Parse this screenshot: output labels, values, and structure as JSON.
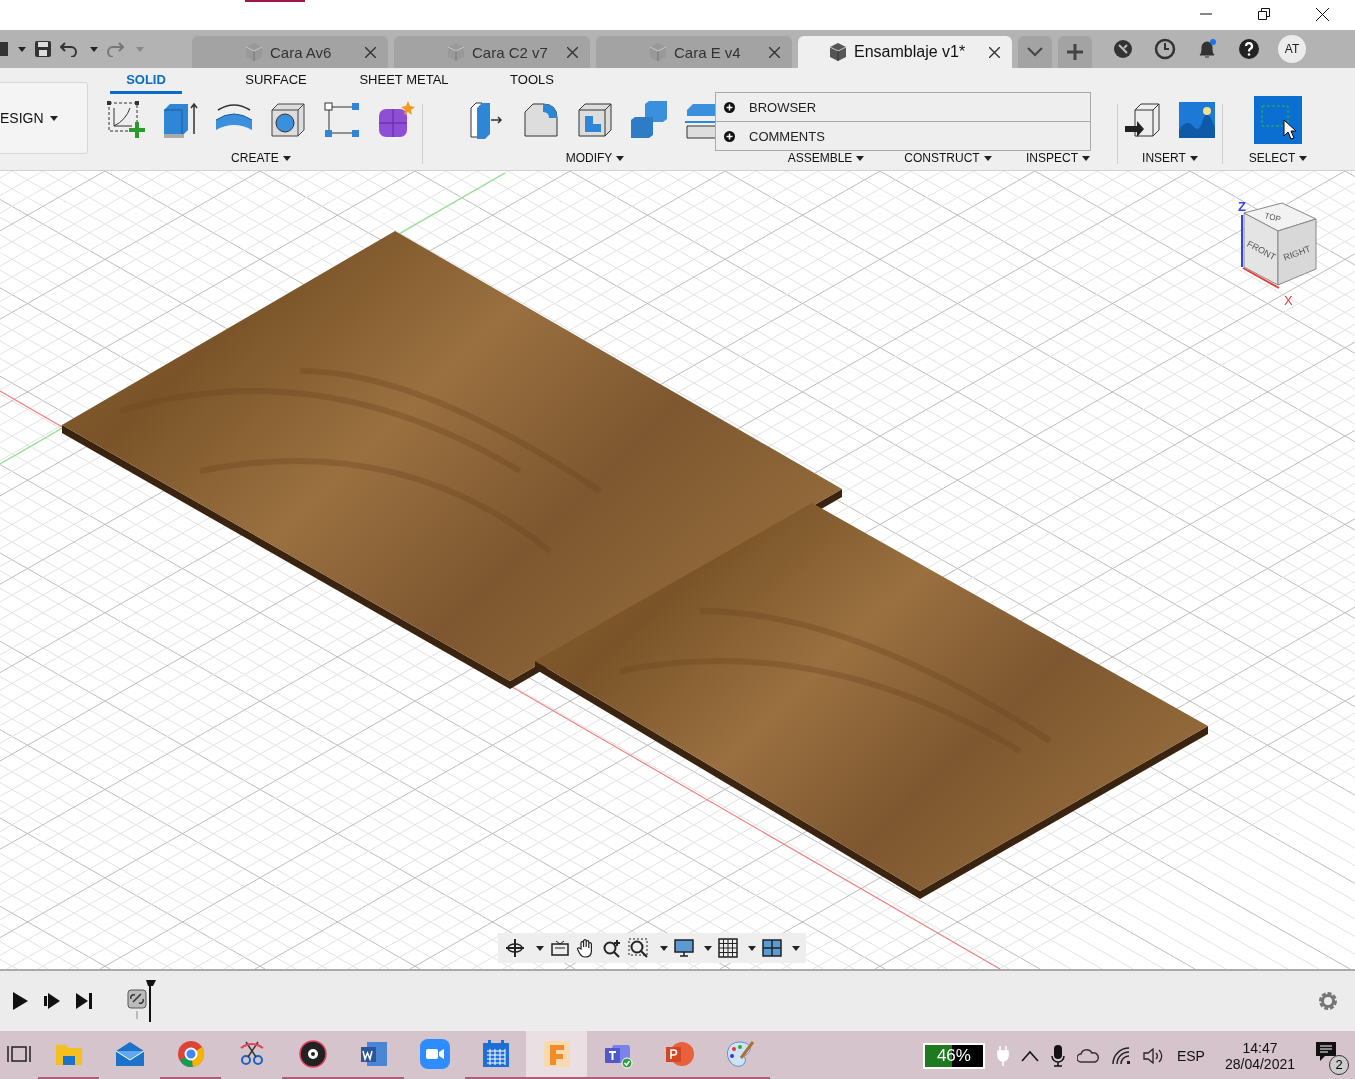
{
  "document_tabs": [
    {
      "label": "Cara Av6",
      "selected": false
    },
    {
      "label": "Cara C2 v7",
      "selected": false
    },
    {
      "label": "Cara E v4",
      "selected": false
    },
    {
      "label": "Ensamblaje v1*",
      "selected": true
    }
  ],
  "user": {
    "initials": "AT"
  },
  "workspace": {
    "label": "ESIGN"
  },
  "ribbon_tabs": [
    {
      "label": "SOLID",
      "selected": true
    },
    {
      "label": "SURFACE",
      "selected": false
    },
    {
      "label": "SHEET METAL",
      "selected": false
    },
    {
      "label": "TOOLS",
      "selected": false
    }
  ],
  "tool_groups": [
    {
      "label": "CREATE",
      "tools": [
        {
          "kind": "sketch"
        },
        {
          "kind": "extrude"
        },
        {
          "kind": "revolve"
        },
        {
          "kind": "hole"
        },
        {
          "kind": "pattern"
        },
        {
          "kind": "form"
        }
      ]
    },
    {
      "label": "MODIFY",
      "tools": [
        {
          "kind": "presspull"
        },
        {
          "kind": "fillet"
        },
        {
          "kind": "shell"
        },
        {
          "kind": "combine"
        },
        {
          "kind": "split"
        }
      ]
    },
    {
      "label": "ASSEMBLE"
    },
    {
      "label": "CONSTRUCT"
    },
    {
      "label": "INSPECT"
    },
    {
      "label": "INSERT",
      "tools": [
        {
          "kind": "derive"
        },
        {
          "kind": "canvas"
        }
      ]
    },
    {
      "label": "SELECT",
      "tools": [
        {
          "kind": "select"
        }
      ]
    }
  ],
  "panels": [
    {
      "label": "BROWSER",
      "expanded": false
    },
    {
      "label": "COMMENTS",
      "expanded": false
    }
  ],
  "viewcube": {
    "top": "TOP",
    "front": "FRONT",
    "right": "RIGHT",
    "axis_z": "Z",
    "axis_x": "X"
  },
  "taskbar": {
    "apps": [
      {
        "kind": "taskview",
        "running": false,
        "selected": false
      },
      {
        "kind": "explorer",
        "running": true,
        "selected": false
      },
      {
        "kind": "mail",
        "running": false,
        "selected": false
      },
      {
        "kind": "chrome",
        "running": true,
        "selected": false
      },
      {
        "kind": "snip",
        "running": false,
        "selected": false
      },
      {
        "kind": "music",
        "running": true,
        "selected": false
      },
      {
        "kind": "word",
        "running": true,
        "selected": false
      },
      {
        "kind": "zoom",
        "running": false,
        "selected": false
      },
      {
        "kind": "calendar",
        "running": true,
        "selected": false
      },
      {
        "kind": "fusion",
        "running": true,
        "selected": true
      },
      {
        "kind": "teams",
        "running": true,
        "selected": false
      },
      {
        "kind": "powerpoint",
        "running": true,
        "selected": false
      },
      {
        "kind": "paint",
        "running": true,
        "selected": false
      }
    ],
    "battery": {
      "reading": "46%",
      "level": 0.46
    },
    "language": "ESP",
    "time": "14:47",
    "date": "28/04/2021",
    "notifications": "2"
  }
}
